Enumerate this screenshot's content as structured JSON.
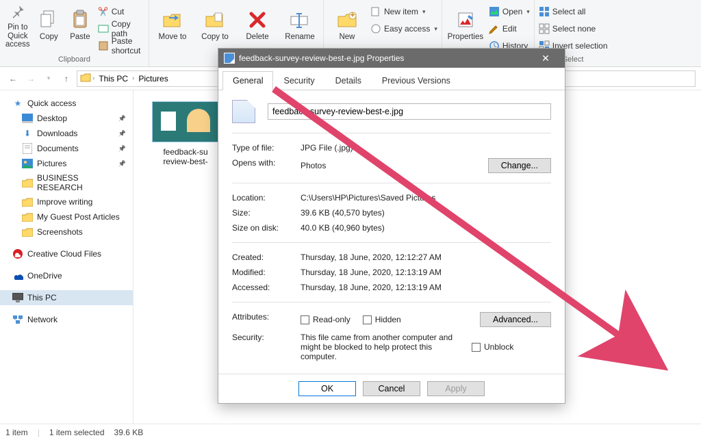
{
  "ribbon": {
    "pin_quick": "Pin to Quick access",
    "copy": "Copy",
    "paste": "Paste",
    "cut": "Cut",
    "copy_path": "Copy path",
    "paste_shortcut": "Paste shortcut",
    "clipboard_label": "Clipboard",
    "move": "Move to",
    "copy_to": "Copy to",
    "delete": "Delete",
    "rename": "Rename",
    "new_folder": "New",
    "new_item": "New item",
    "easy_access": "Easy access",
    "properties": "Properties",
    "open": "Open",
    "edit": "Edit",
    "history": "History",
    "select_all": "Select all",
    "select_none": "Select none",
    "invert_selection": "Invert selection",
    "select_label": "Select"
  },
  "path": {
    "seg1": "This PC",
    "seg2": "Pictures"
  },
  "sidebar": {
    "quick": "Quick access",
    "desktop": "Desktop",
    "downloads": "Downloads",
    "documents": "Documents",
    "pictures": "Pictures",
    "business": "BUSINESS RESEARCH",
    "improve": "Improve writing",
    "guest": "My Guest Post Articles",
    "screenshots": "Screenshots",
    "ccf": "Creative Cloud Files",
    "onedrive": "OneDrive",
    "thispc": "This PC",
    "network": "Network"
  },
  "thumb": {
    "line1": "feedback-su",
    "line2": "review-best-"
  },
  "status": {
    "items": "1 item",
    "selected": "1 item selected",
    "size": "39.6 KB"
  },
  "dialog": {
    "title": "feedback-survey-review-best-e.jpg Properties",
    "tabs": {
      "general": "General",
      "security": "Security",
      "details": "Details",
      "previous": "Previous Versions"
    },
    "filename": "feedback-survey-review-best-e.jpg",
    "type_lbl": "Type of file:",
    "type_val": "JPG File (.jpg)",
    "opens_lbl": "Opens with:",
    "opens_val": "Photos",
    "change": "Change...",
    "loc_lbl": "Location:",
    "loc_val": "C:\\Users\\HP\\Pictures\\Saved Pictures",
    "size_lbl": "Size:",
    "size_val": "39.6 KB (40,570 bytes)",
    "disk_lbl": "Size on disk:",
    "disk_val": "40.0 KB (40,960 bytes)",
    "created_lbl": "Created:",
    "created_val": "Thursday, 18 June, 2020, 12:12:27 AM",
    "modified_lbl": "Modified:",
    "modified_val": "Thursday, 18 June, 2020, 12:13:19 AM",
    "accessed_lbl": "Accessed:",
    "accessed_val": "Thursday, 18 June, 2020, 12:13:19 AM",
    "attr_lbl": "Attributes:",
    "readonly": "Read-only",
    "hidden": "Hidden",
    "advanced": "Advanced...",
    "sec_lbl": "Security:",
    "sec_val": "This file came from another computer and might be blocked to help protect this computer.",
    "unblock": "Unblock",
    "ok": "OK",
    "cancel": "Cancel",
    "apply": "Apply"
  }
}
